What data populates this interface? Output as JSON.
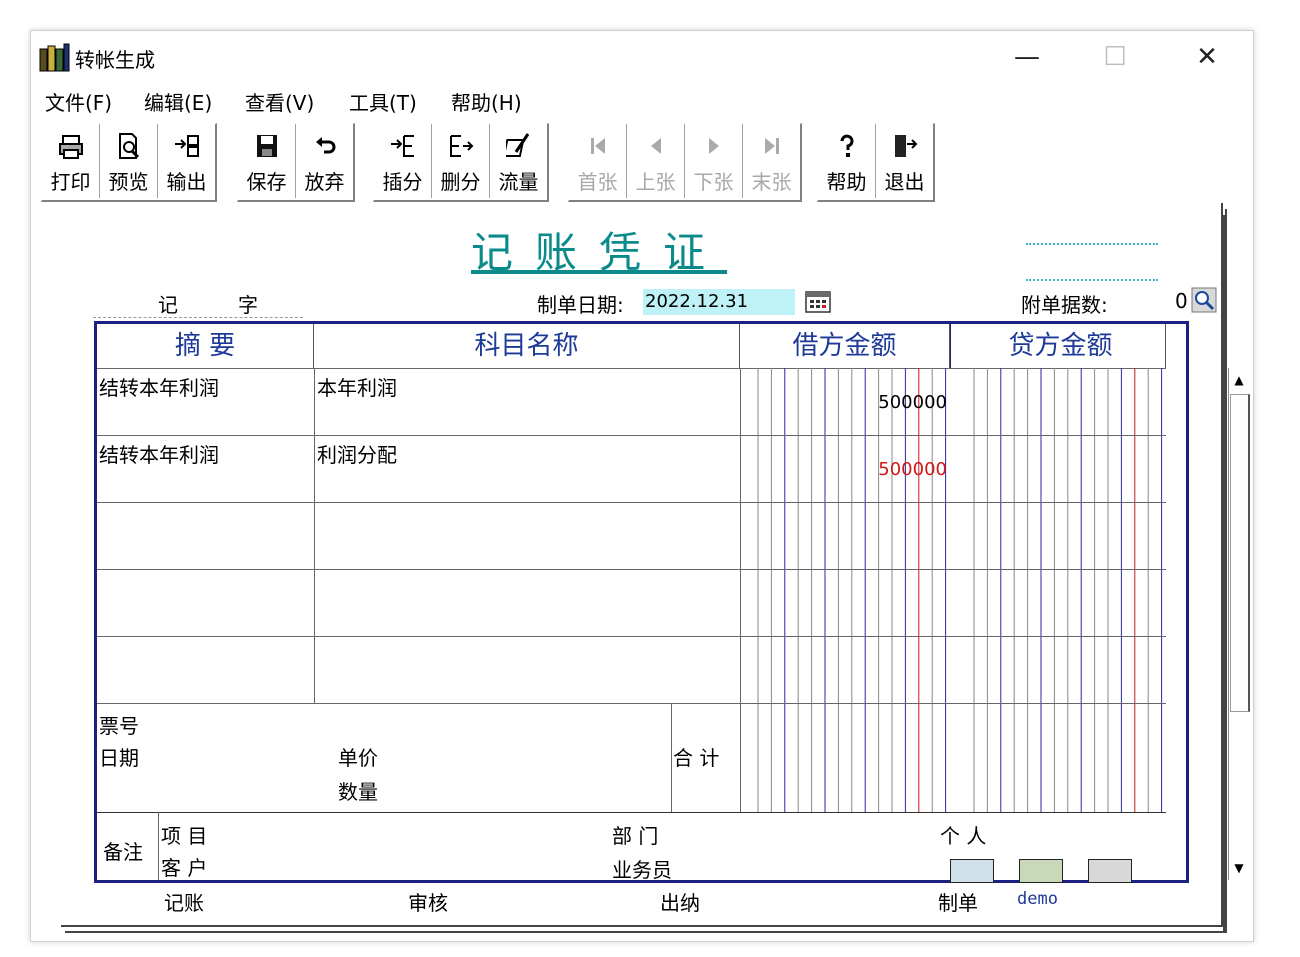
{
  "window": {
    "title": "转帐生成",
    "controls": {
      "minimize": "—",
      "maximize": "☐",
      "close": "✕"
    }
  },
  "menu": [
    {
      "label": "文件(F)"
    },
    {
      "label": "编辑(E)"
    },
    {
      "label": "查看(V)"
    },
    {
      "label": "工具(T)"
    },
    {
      "label": "帮助(H)"
    }
  ],
  "toolbar": {
    "print": "打印",
    "preview": "预览",
    "export": "输出",
    "save": "保存",
    "discard": "放弃",
    "insert_line": "插分",
    "delete_line": "删分",
    "cash_flow": "流量",
    "first": "首张",
    "prev": "上张",
    "next": "下张",
    "last": "末张",
    "help": "帮助",
    "exit": "退出"
  },
  "voucher": {
    "title": "记账凭证",
    "type_label_1": "记",
    "type_label_2": "字",
    "date_label": "制单日期:",
    "date_value": "2022.12.31",
    "attachments_label": "附单据数:",
    "attachments_value": "0",
    "columns": {
      "summary": "摘 要",
      "account": "科目名称",
      "debit": "借方金额",
      "credit": "贷方金额"
    },
    "rows": [
      {
        "summary": "结转本年利润",
        "account": "本年利润",
        "debit": "500000",
        "debit_color": "#000000"
      },
      {
        "summary": "结转本年利润",
        "account": "利润分配",
        "debit": "500000",
        "debit_color": "#d01818"
      }
    ],
    "footer": {
      "ticket_no": "票号",
      "date": "日期",
      "unit_price": "单价",
      "quantity": "数量",
      "total": "合 计",
      "remark": "备注",
      "project": "项  目",
      "customer": "客  户",
      "department": "部  门",
      "salesperson": "业务员",
      "person": "个  人"
    },
    "signatures": {
      "bookkeeping": "记账",
      "audit": "审核",
      "cashier": "出纳",
      "maker": "制单",
      "maker_value": "demo"
    }
  },
  "colors": {
    "title_teal": "#0a8a8a",
    "header_blue": "#1e3a98",
    "grid_border": "#1c2080",
    "ledger_blue": "#2a2aa0",
    "ledger_red": "#d01818",
    "date_bg": "#bff2f6"
  }
}
